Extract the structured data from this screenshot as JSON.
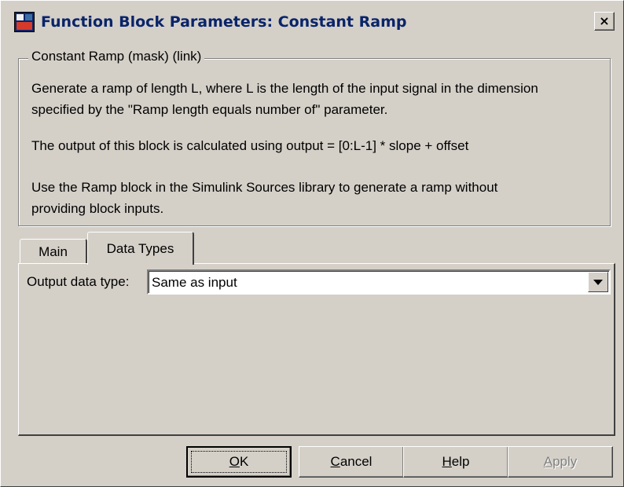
{
  "window": {
    "title": "Function Block Parameters: Constant Ramp",
    "close_glyph": "×"
  },
  "group": {
    "legend": "Constant Ramp (mask) (link)",
    "description_lines": [
      "Generate a ramp of length L, where L is the length of the input signal in the dimension",
      "specified by the \"Ramp length equals number of\" parameter.",
      "The output of this block is calculated using output = [0:L-1] * slope + offset",
      "Use the Ramp block in the Simulink Sources library to generate a ramp without",
      "providing block inputs."
    ]
  },
  "tabs": [
    {
      "label": "Main",
      "selected": false
    },
    {
      "label": "Data Types",
      "selected": true
    }
  ],
  "output_data_type": {
    "label": "Output data type:",
    "value": "Same as input"
  },
  "buttons": {
    "ok": {
      "mnemonic": "O",
      "rest": "K"
    },
    "cancel": {
      "mnemonic": "C",
      "rest": "ancel"
    },
    "help": {
      "mnemonic": "H",
      "rest": "elp"
    },
    "apply": {
      "mnemonic": "A",
      "rest": "pply",
      "enabled": false
    }
  },
  "icons": {
    "app": "simulink-block-icon",
    "close": "close-icon",
    "dropdown": "chevron-down-icon"
  },
  "colors": {
    "face": "#d4d0c8",
    "title_text": "#0a246a",
    "disabled_text": "#808080"
  }
}
